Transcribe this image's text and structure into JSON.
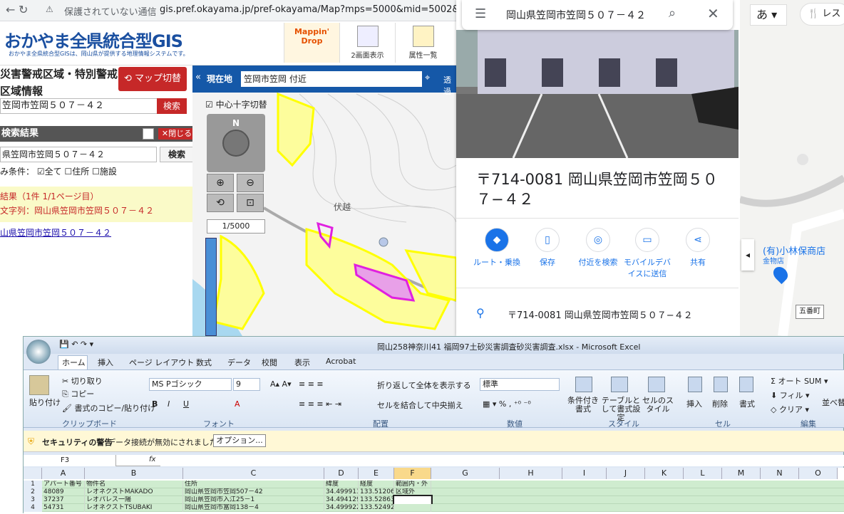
{
  "browser": {
    "warning": "保護されていない通信",
    "url": "gis.pref.okayama.jp/pref-okayama/Map?mps=5000&mid=5002&mtp"
  },
  "gis": {
    "logo": "おかやま全県統合型GIS",
    "logo_sub": "おかやま全県統合型GISは、岡山県が提供する地理情報システムです。",
    "buttons": [
      {
        "label": "Mappin' Drop"
      },
      {
        "label": "2画面表示"
      },
      {
        "label": "属性一覧"
      }
    ],
    "panel_title": "災害警戒区域・特別警戒区域情報",
    "map_switch": "マップ切替",
    "address_value": "笠岡市笠岡５０７－４２",
    "search_label": "検索",
    "results_header": "検索結果",
    "close_label": "閉じる",
    "query_value": "県笠岡市笠岡５０７－４２",
    "query_search": "検索",
    "filter_label": "み条件：",
    "filter_options": [
      "全て",
      "住所",
      "施設"
    ],
    "result_count": "結果（1件 1/1ページ目）",
    "result_query": "文字列：岡山県笠岡市笠岡５０７－４２",
    "result_link": "山県笠岡市笠岡５０７－４２"
  },
  "map": {
    "current_label": "現在地",
    "current_value": "笠岡市笠岡 付近",
    "transparency": "透過",
    "crosshair_label": "中心十字切替",
    "scale": "1/5000",
    "place_label": "伏越",
    "compass_n": "N"
  },
  "gmaps": {
    "search_query": "岡山県笠岡市笠岡５０７－４２",
    "title": "〒714-0081 岡山県笠岡市笠岡５０７−４２",
    "actions": [
      "ルート・乗換",
      "保存",
      "付近を検索",
      "モバイルデバイスに送信",
      "共有"
    ],
    "address": "〒714-0081 岡山県笠岡市笠岡５０７−４２",
    "ime": "あ",
    "rest": "レス",
    "poi_name": "(有)小林保商店",
    "poi_type": "金物店",
    "road_sign": "五番町"
  },
  "excel": {
    "title": "岡山258神奈川41 福岡97土砂災害調査砂災害調査.xlsx - Microsoft Excel",
    "tabs": [
      "ホーム",
      "挿入",
      "ページ レイアウト",
      "数式",
      "データ",
      "校閲",
      "表示",
      "Acrobat"
    ],
    "clipboard": [
      "切り取り",
      "コピー",
      "書式のコピー/貼り付け",
      "貼り付け"
    ],
    "font_name": "MS Pゴシック",
    "font_size": "9",
    "wrap": "折り返して全体を表示する",
    "merge": "セルを結合して中央揃え",
    "number_format": "標準",
    "styles": [
      "条件付き書式",
      "テーブルとして書式設定",
      "セルのスタイル"
    ],
    "cells_grp": [
      "挿入",
      "削除",
      "書式"
    ],
    "edit": [
      "オート SUM",
      "フィル",
      "クリア",
      "並べ替え"
    ],
    "groups": [
      "クリップボード",
      "フォント",
      "配置",
      "数値",
      "スタイル",
      "セル",
      "編集"
    ],
    "security_title": "セキュリティの警告",
    "security_msg": "データ接続が無効にされました",
    "options": "オプション...",
    "name_box": "F3",
    "fx": "fx",
    "columns": [
      "A",
      "B",
      "C",
      "D",
      "E",
      "F",
      "G",
      "H",
      "I",
      "J",
      "K",
      "L",
      "M",
      "N",
      "O"
    ],
    "rows": [
      [
        "1",
        "アパート番号",
        "物件名",
        "住所",
        "緯度",
        "経度",
        "範囲内・外"
      ],
      [
        "2",
        "48089",
        "レオネクストMAKADO",
        "岡山県笠岡市笠岡507－42",
        "34.499913",
        "133.512066",
        "区域外"
      ],
      [
        "3",
        "37237",
        "レオパレス一陽",
        "岡山県笠岡市入江25－1",
        "34.494129",
        "133.528636",
        ""
      ],
      [
        "4",
        "54731",
        "レオネクストTSUBAKI",
        "岡山県笠岡市富岡138－4",
        "34.499922",
        "133.524924",
        ""
      ]
    ]
  }
}
